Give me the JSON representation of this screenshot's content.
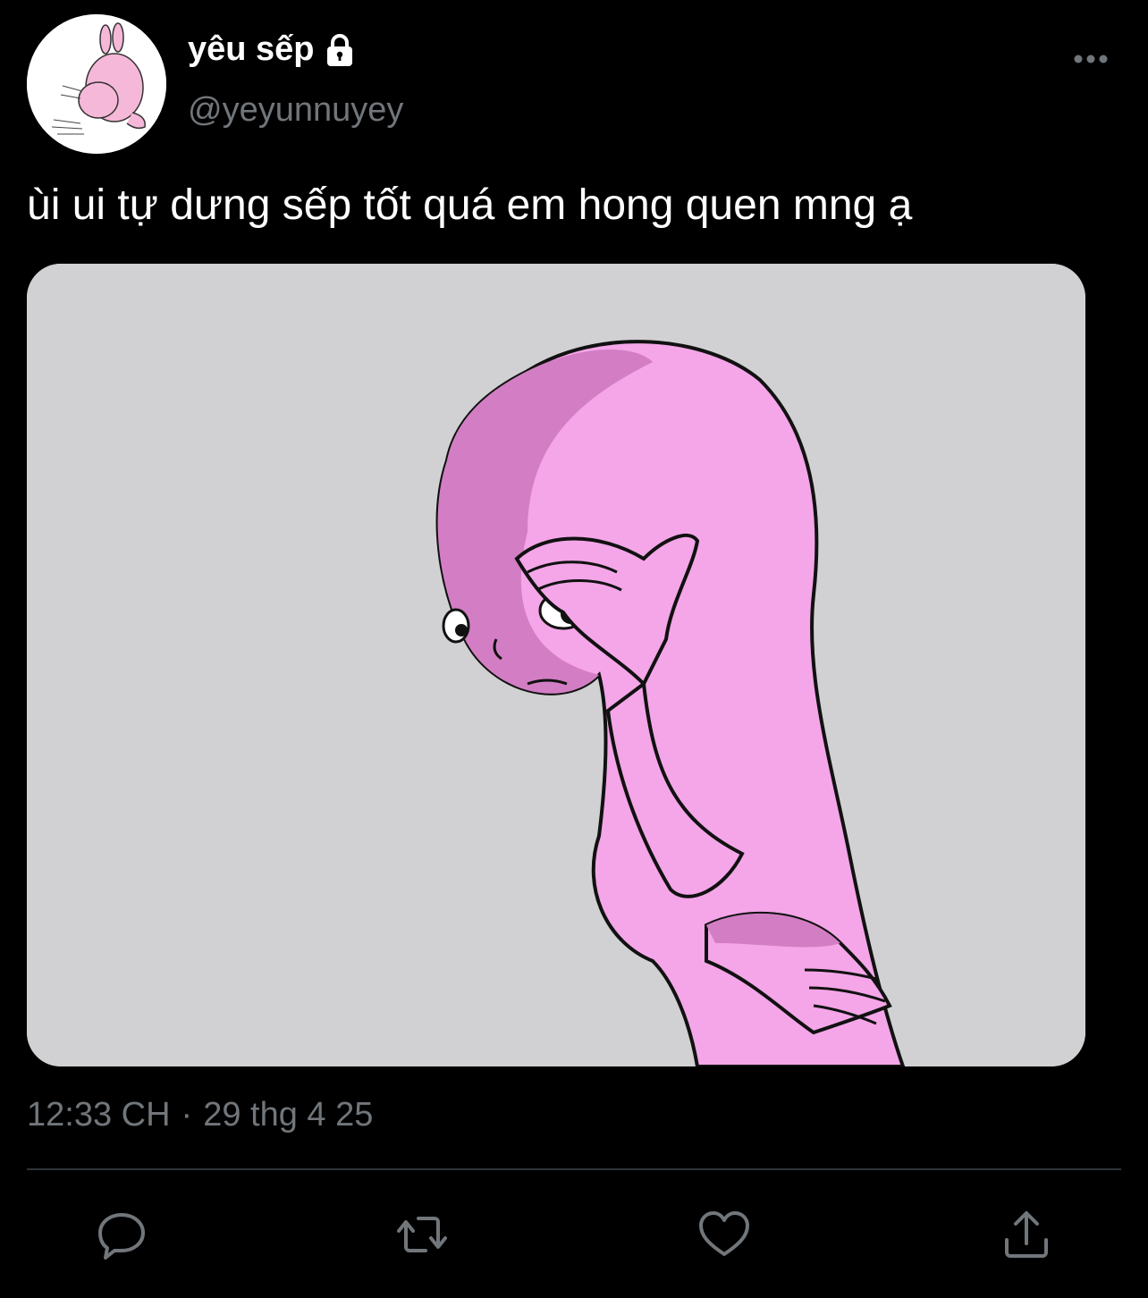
{
  "author": {
    "display_name": "yêu sếp",
    "handle": "@yeyunnuyey",
    "avatar_icon": "pink-bunny-avatar",
    "protected_icon": "lock-icon"
  },
  "tweet": {
    "text": "ùi ui tự dưng sếp tốt quá em hong quen mng ạ",
    "media_description": "pink-cartoon-character-rubbing-head-image",
    "time": "12:33 CH",
    "separator": "·",
    "date": "29 thg 4 25"
  },
  "actions": [
    {
      "icon": "reply-icon"
    },
    {
      "icon": "retweet-icon"
    },
    {
      "icon": "like-icon"
    },
    {
      "icon": "share-icon"
    }
  ],
  "colors": {
    "background": "#000000",
    "text_primary": "#ffffff",
    "text_secondary": "#71767b",
    "divider": "#2f3336",
    "icon": "#71767b",
    "media_background": "#d1d1d3",
    "character_pink": "#f4a6e8"
  }
}
